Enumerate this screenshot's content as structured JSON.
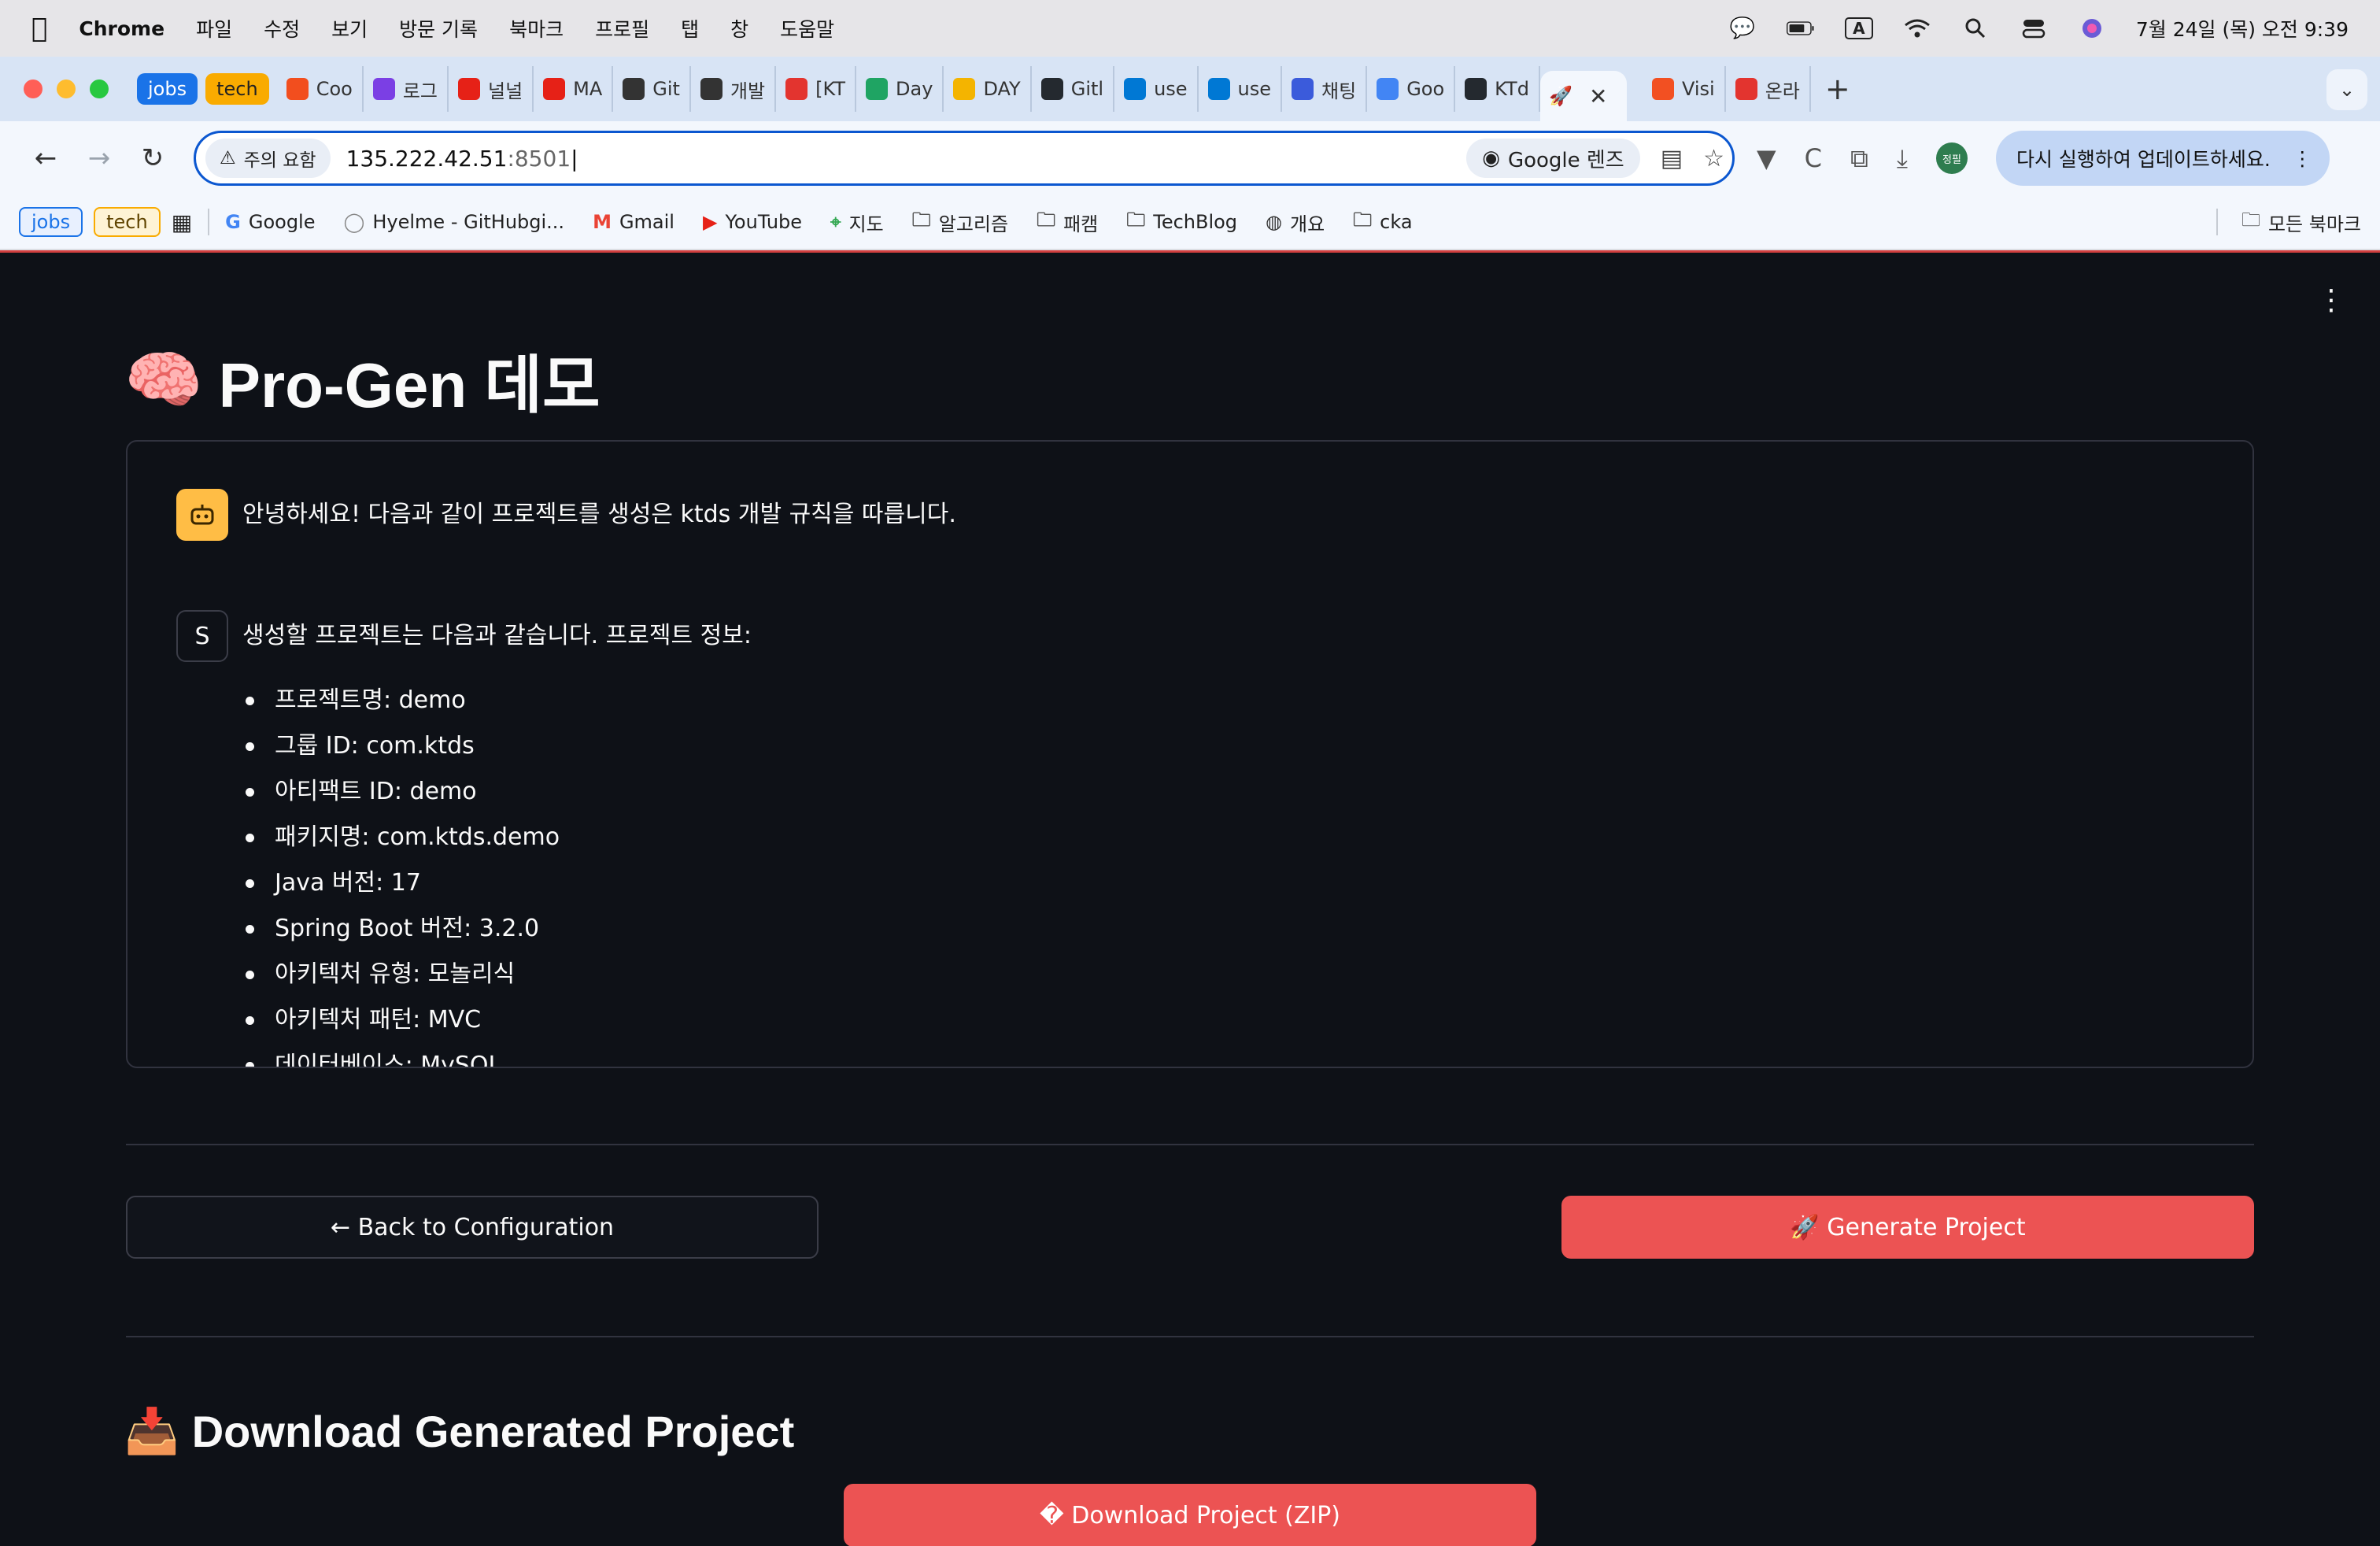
{
  "menubar": {
    "app_name": "Chrome",
    "items": [
      "파일",
      "수정",
      "보기",
      "방문 기록",
      "북마크",
      "프로필",
      "탭",
      "창",
      "도움말"
    ],
    "keyboard_indicator": "A",
    "datetime": "7월 24일 (목) 오전 9:39"
  },
  "tabs": {
    "group_jobs": "jobs",
    "group_tech": "tech",
    "items": [
      {
        "label": "Coo",
        "icon": "figma-icon",
        "color": "#f24e1e"
      },
      {
        "label": "로그",
        "icon": "u-icon",
        "color": "#7b3fe4"
      },
      {
        "label": "널널",
        "icon": "youtube-icon",
        "color": "#e62117"
      },
      {
        "label": "MA",
        "icon": "youtube-icon",
        "color": "#e62117"
      },
      {
        "label": "Git",
        "icon": "openai-icon",
        "color": "#333333"
      },
      {
        "label": "개발",
        "icon": "openai-icon",
        "color": "#333333"
      },
      {
        "label": "[KT",
        "icon": "ktds-icon",
        "color": "#e3342f"
      },
      {
        "label": "Day",
        "icon": "drive-icon",
        "color": "#1fa463"
      },
      {
        "label": "DAY",
        "icon": "slides-icon",
        "color": "#f4b400"
      },
      {
        "label": "Gitl",
        "icon": "github-icon",
        "color": "#24292f"
      },
      {
        "label": "use",
        "icon": "azure-icon",
        "color": "#0078d4"
      },
      {
        "label": "use",
        "icon": "azure-icon",
        "color": "#0078d4"
      },
      {
        "label": "채팅",
        "icon": "copilot-icon",
        "color": "#3b5bdb"
      },
      {
        "label": "Goo",
        "icon": "gemini-icon",
        "color": "#4285f4"
      },
      {
        "label": "KTd",
        "icon": "github-icon",
        "color": "#24292f"
      }
    ],
    "active_icon": "rocket-icon",
    "after_active": [
      {
        "label": "Visi",
        "icon": "microsoft-icon",
        "color": "#f25022"
      },
      {
        "label": "온라",
        "icon": "ktds-icon",
        "color": "#e3342f"
      }
    ]
  },
  "toolbar": {
    "security_label": "주의 요함",
    "url_host": "135.222.42.51",
    "url_port": ":8501",
    "lens_label": "Google 렌즈",
    "profile_label": "정필",
    "update_label": "다시 실행하여 업데이트하세요."
  },
  "bookmarks": {
    "tag_jobs": "jobs",
    "tag_tech": "tech",
    "items": [
      {
        "label": "Google",
        "icon": "google-icon"
      },
      {
        "label": "Hyelme - GitHubgi...",
        "icon": "github-icon"
      },
      {
        "label": "Gmail",
        "icon": "gmail-icon"
      },
      {
        "label": "YouTube",
        "icon": "youtube-icon"
      },
      {
        "label": "지도",
        "icon": "maps-icon"
      },
      {
        "label": "알고리즘",
        "icon": "folder-icon"
      },
      {
        "label": "패캠",
        "icon": "folder-icon"
      },
      {
        "label": "TechBlog",
        "icon": "folder-icon"
      },
      {
        "label": "개요",
        "icon": "globe-icon"
      },
      {
        "label": "cka",
        "icon": "folder-icon"
      }
    ],
    "all_bookmarks": "모든 북마크"
  },
  "app": {
    "title_emoji": "🧠",
    "title": "Pro-Gen 데모",
    "assistant_message": "안녕하세요! 다음과 같이 프로젝트를 생성은 ktds 개발 규칙을 따릅니다.",
    "user_avatar": "S",
    "user_message": "생성할 프로젝트는 다음과 같습니다. 프로젝트 정보:",
    "project_info": [
      "프로젝트명: demo",
      "그룹 ID: com.ktds",
      "아티팩트 ID: demo",
      "패키지명: com.ktds.demo",
      "Java 버전: 17",
      "Spring Boot 버전: 3.2.0",
      "아키텍처 유형: 모놀리식",
      "아키텍처 패턴: MVC",
      "데이터베이스: MySQL"
    ],
    "back_button": "← Back to Configuration",
    "generate_button": "🚀 Generate Project",
    "download_emoji": "📥",
    "download_title": "Download Generated Project",
    "download_button": "� Download Project (ZIP)"
  }
}
